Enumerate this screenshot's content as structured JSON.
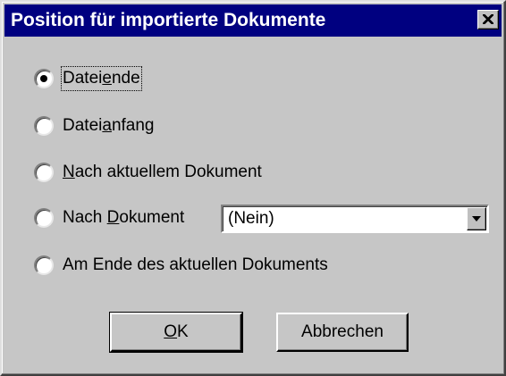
{
  "dialog": {
    "title": "Position für importierte Dokumente"
  },
  "options": {
    "dateiende": {
      "pre": "Datei",
      "accel": "e",
      "post": "nde",
      "checked": true
    },
    "dateianfang": {
      "pre": "Datei",
      "accel": "a",
      "post": "nfang",
      "checked": false
    },
    "nach_aktuellem": {
      "pre": "",
      "accel": "N",
      "post": "ach aktuellem Dokument",
      "checked": false
    },
    "nach_dokument": {
      "pre": "Nach ",
      "accel": "D",
      "post": "okument",
      "checked": false
    },
    "am_ende": {
      "pre": "Am Ende des aktuellen Dokuments",
      "accel": "",
      "post": "",
      "checked": false
    }
  },
  "dropdown": {
    "selected": "(Nein)"
  },
  "buttons": {
    "ok": {
      "accel": "O",
      "post": "K"
    },
    "cancel": "Abbrechen"
  },
  "icons": {
    "close": "close-icon",
    "dropdown": "chevron-down-icon"
  },
  "colors": {
    "titlebar": "#000080",
    "face": "#c0c0c0"
  }
}
